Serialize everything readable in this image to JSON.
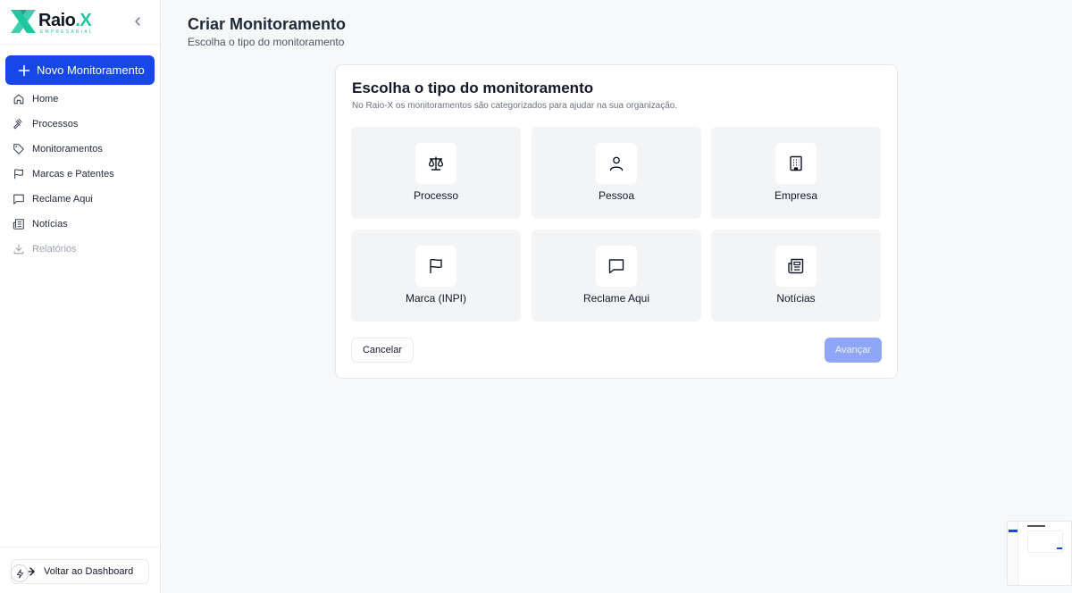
{
  "sidebar": {
    "logo": {
      "text": "Raio",
      "dot": ".X",
      "sub": "EMPRESARIAL"
    },
    "new_button": "Novo Monitoramento",
    "items": [
      {
        "label": "Home",
        "icon": "home-icon"
      },
      {
        "label": "Processos",
        "icon": "gavel-icon"
      },
      {
        "label": "Monitoramentos",
        "icon": "tag-icon"
      },
      {
        "label": "Marcas e Patentes",
        "icon": "flag-icon"
      },
      {
        "label": "Reclame Aqui",
        "icon": "chat-icon"
      },
      {
        "label": "Notícias",
        "icon": "newspaper-icon"
      },
      {
        "label": "Relatórios",
        "icon": "download-icon",
        "disabled": true
      }
    ],
    "back_button": "Voltar ao Dashboard"
  },
  "header": {
    "title": "Criar Monitoramento",
    "subtitle": "Escolha o tipo do monitoramento"
  },
  "card": {
    "title": "Escolha o tipo do monitoramento",
    "description": "No Raio-X os monitoramentos são categorizados para ajudar na sua organização.",
    "types": [
      {
        "label": "Processo",
        "icon": "scale-icon"
      },
      {
        "label": "Pessoa",
        "icon": "person-icon"
      },
      {
        "label": "Empresa",
        "icon": "building-icon"
      },
      {
        "label": "Marca (INPI)",
        "icon": "flag-icon"
      },
      {
        "label": "Reclame Aqui",
        "icon": "chat-icon"
      },
      {
        "label": "Notícias",
        "icon": "newspaper-icon"
      }
    ],
    "cancel_label": "Cancelar",
    "next_label": "Avançar"
  },
  "colors": {
    "primary": "#1747e8",
    "brand_green": "#1fc7a0",
    "tile_bg": "#f3f4f6",
    "next_disabled": "#8fa5f7"
  }
}
